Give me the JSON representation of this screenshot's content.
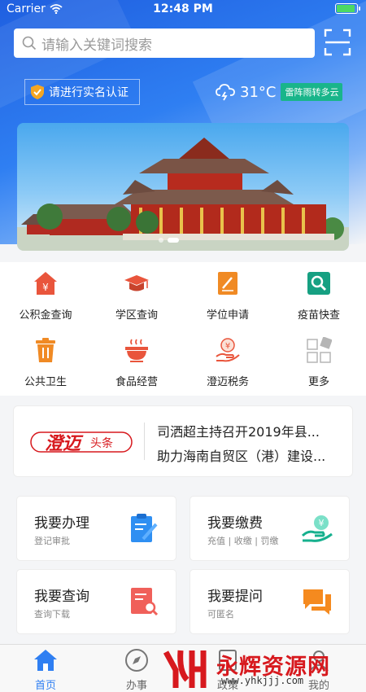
{
  "status_bar": {
    "carrier": "Carrier",
    "time": "12:48 PM"
  },
  "search": {
    "placeholder": "请输入关键词搜索"
  },
  "realname": {
    "label": "请进行实名认证"
  },
  "weather": {
    "temperature": "31°C",
    "condition": "雷阵雨转多云"
  },
  "banner": {
    "pages": 2,
    "active_page": 2
  },
  "services": [
    {
      "label": "公积金查询",
      "icon": "housing-fund-icon",
      "color": "#e9553c"
    },
    {
      "label": "学区查询",
      "icon": "mortarboard-icon",
      "color": "#e9553c"
    },
    {
      "label": "学位申请",
      "icon": "pencil-document-icon",
      "color": "#f08a24"
    },
    {
      "label": "疫苗快查",
      "icon": "magnifier-icon",
      "color": "#16a082"
    },
    {
      "label": "公共卫生",
      "icon": "trash-bin-icon",
      "color": "#f08a24"
    },
    {
      "label": "食品经营",
      "icon": "food-bowl-icon",
      "color": "#e9553c"
    },
    {
      "label": "澄迈税务",
      "icon": "tax-hand-icon",
      "color": "#e9553c"
    },
    {
      "label": "更多",
      "icon": "more-grid-icon",
      "color": "#aaaaaa"
    }
  ],
  "news": {
    "logo_main": "澄迈",
    "logo_sub": "头条",
    "headlines": [
      "司洒超主持召开2019年县...",
      "助力海南自贸区（港）建设..."
    ]
  },
  "cards": [
    {
      "title": "我要办理",
      "subtitle": "登记审批",
      "icon": "clipboard-edit-icon"
    },
    {
      "title": "我要缴费",
      "subtitle": "充值 | 收缴 | 罚缴",
      "icon": "payment-hand-icon"
    },
    {
      "title": "我要查询",
      "subtitle": "查询下载",
      "icon": "document-search-icon"
    },
    {
      "title": "我要提问",
      "subtitle": "可匿名",
      "icon": "chat-bubbles-icon"
    }
  ],
  "tabbar": {
    "items": [
      {
        "label": "首页",
        "icon": "home-icon",
        "active": true
      },
      {
        "label": "办事",
        "icon": "compass-icon",
        "active": false
      },
      {
        "label": "政策",
        "icon": "policy-icon",
        "active": false
      },
      {
        "label": "我的",
        "icon": "user-icon",
        "active": false
      }
    ]
  },
  "watermark": {
    "text": "永辉资源网",
    "url": "www.yhkjjj.com"
  },
  "colors": {
    "accent": "#2f7ff2",
    "brand_red": "#d7191e",
    "weather_badge": "#19b58a"
  }
}
